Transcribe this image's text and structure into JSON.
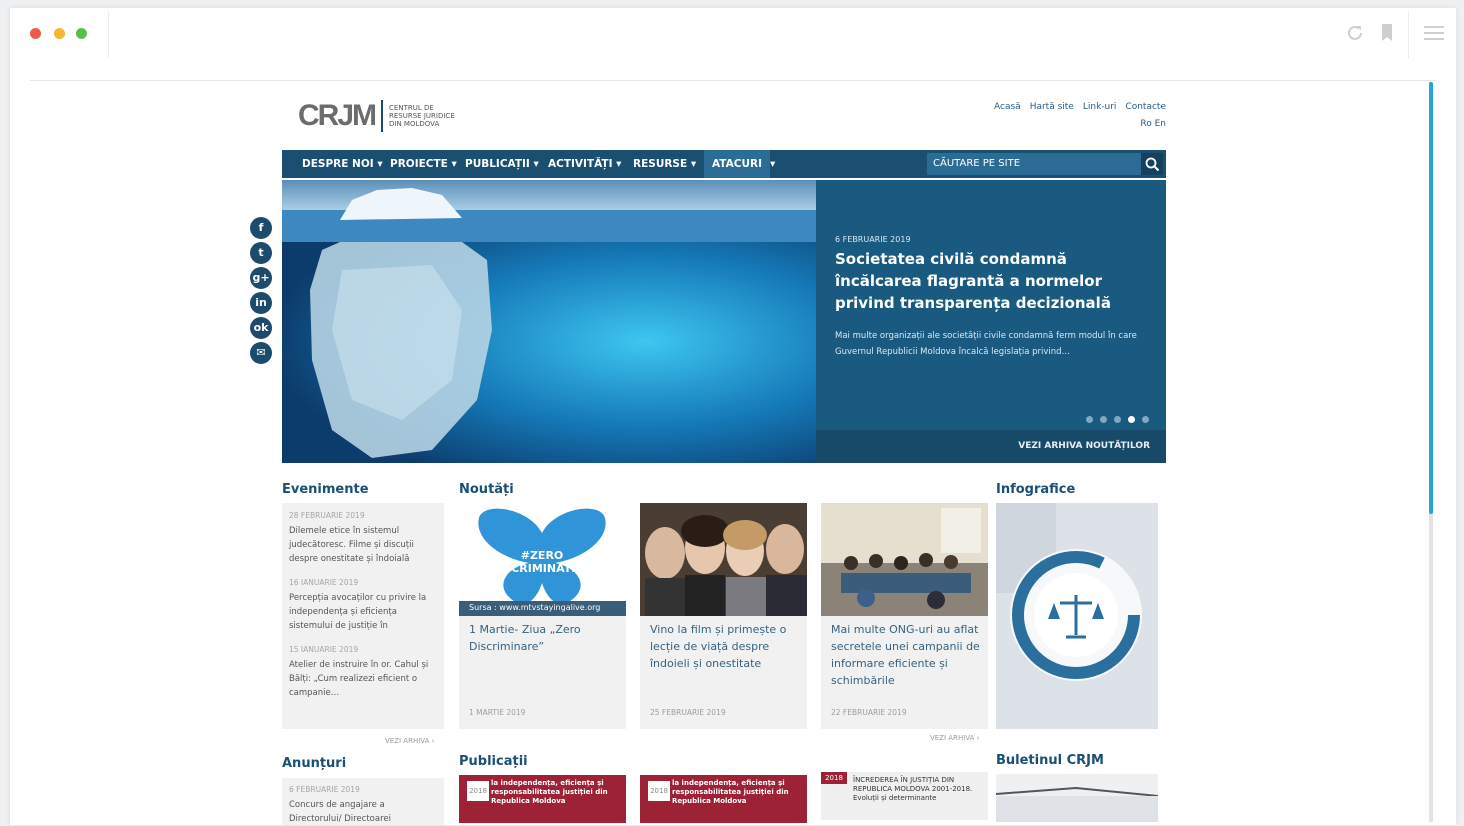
{
  "site": {
    "logo_mark": "CRJM",
    "logo_text": "CENTRUL DE RESURSE JURIDICE DIN MOLDOVA",
    "top_links": [
      "Acasă",
      "Hartă site",
      "Link-uri",
      "Contacte"
    ],
    "lang": "Ro En"
  },
  "nav": {
    "items": [
      "DESPRE NOI ▾",
      "PROIECTE ▾",
      "PUBLICAȚII ▾",
      "ACTIVITĂȚI ▾",
      "RESURSE ▾",
      "ATACURI",
      "▾"
    ],
    "search_placeholder": "CĂUTARE PE SITE"
  },
  "hero": {
    "date": "6 FEBRUARIE 2019",
    "title": "Societatea civilă condamnă încălcarea flagrantă a normelor privind transparența decizională",
    "summary": "Mai multe organizații ale societății civile condamnă ferm modul în care Guvernul Republicii Moldova încalcă legislația privind…",
    "archive_link": "VEZI ARHIVA NOUTĂȚILOR",
    "slides_total": 5,
    "active_slide": 4
  },
  "social": [
    "facebook",
    "twitter",
    "google-plus",
    "linkedin",
    "odnoklassniki",
    "email"
  ],
  "sections": {
    "evenimente": "Evenimente",
    "noutati": "Noutăți",
    "infografice": "Infografice",
    "anunturi": "Anunțuri",
    "publicatii": "Publicații",
    "buletinul": "Buletinul CRJM"
  },
  "events": [
    {
      "date": "28 FEBRUARIE 2019",
      "text": "Dilemele etice în sistemul judecătoresc. Filme și discuții despre onestitate și îndoială"
    },
    {
      "date": "16 IANUARIE 2019",
      "text": "Percepția avocaților cu privire la independența și eficiența sistemului de justiție în"
    },
    {
      "date": "15 IANUARIE 2019",
      "text": "Atelier de instruire în or. Cahul și Bălți: „Cum realizezi eficient o campanie…"
    }
  ],
  "events_archive": "VEZI ARHIVA ›",
  "news": [
    {
      "title": "1 Martie- Ziua „Zero Discriminare”",
      "date": "1 MARTIE 2019",
      "image_caption": "#ZERO DISCRIMINATION",
      "source": "Sursa : www.mtvstayingalive.org"
    },
    {
      "title": "Vino la film și primește o lecție de viață despre îndoieli și onestitate",
      "date": "25 FEBRUARIE 2019"
    },
    {
      "title": "Mai multe ONG-uri au aflat secretele unei campanii de informare eficiente și schimbările",
      "date": "22 FEBRUARIE 2019"
    }
  ],
  "news_archive": "VEZI ARHIVA ›",
  "announcements": [
    {
      "date": "6 FEBRUARIE 2019",
      "text": "Concurs de angajare a Directorului/ Directoarei"
    }
  ],
  "publications": [
    {
      "year": "2018",
      "text": "la independența, eficiența și responsabilitatea justiției din Republica Moldova"
    },
    {
      "year": "2018",
      "text": "la independența, eficiența și responsabilitatea justiției din Republica Moldova"
    },
    {
      "year": "2018",
      "text": "ÎNCREDEREA ÎN JUSTIȚIA DIN REPUBLICA MOLDOVA 2001-2018. Evoluții și determinante"
    }
  ],
  "colors": {
    "brand": "#1b4f72",
    "accent": "#2aa3dd",
    "publication": "#9d2235"
  }
}
